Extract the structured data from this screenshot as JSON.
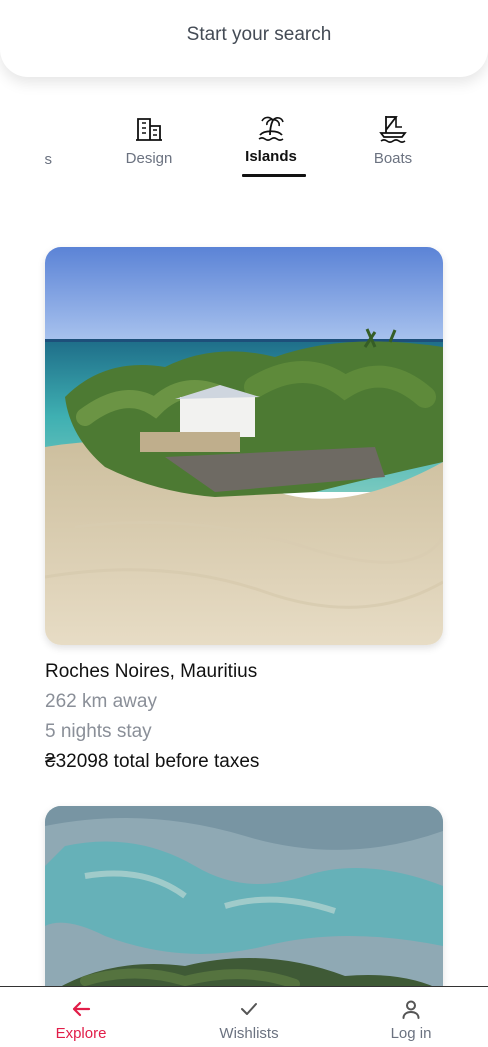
{
  "search": {
    "label": "Start your search"
  },
  "categories": {
    "partial_label": "s",
    "items": [
      {
        "label": "Design",
        "icon": "building-icon"
      },
      {
        "label": "Islands",
        "icon": "palm-island-icon",
        "active": true
      },
      {
        "label": "Boats",
        "icon": "sailboat-icon"
      }
    ]
  },
  "listings": [
    {
      "location": "Roches Noires, Mauritius",
      "distance": "262 km away",
      "stay": "5 nights stay",
      "price": "₴32098 total before taxes"
    }
  ],
  "bottom_nav": {
    "items": [
      {
        "label": "Explore",
        "icon": "arrow-left-icon",
        "active": true
      },
      {
        "label": "Wishlists",
        "icon": "check-icon"
      },
      {
        "label": "Log in",
        "icon": "user-icon"
      }
    ]
  },
  "colors": {
    "accent": "#e11d48",
    "text": "#222222",
    "muted": "#8a8f98"
  }
}
